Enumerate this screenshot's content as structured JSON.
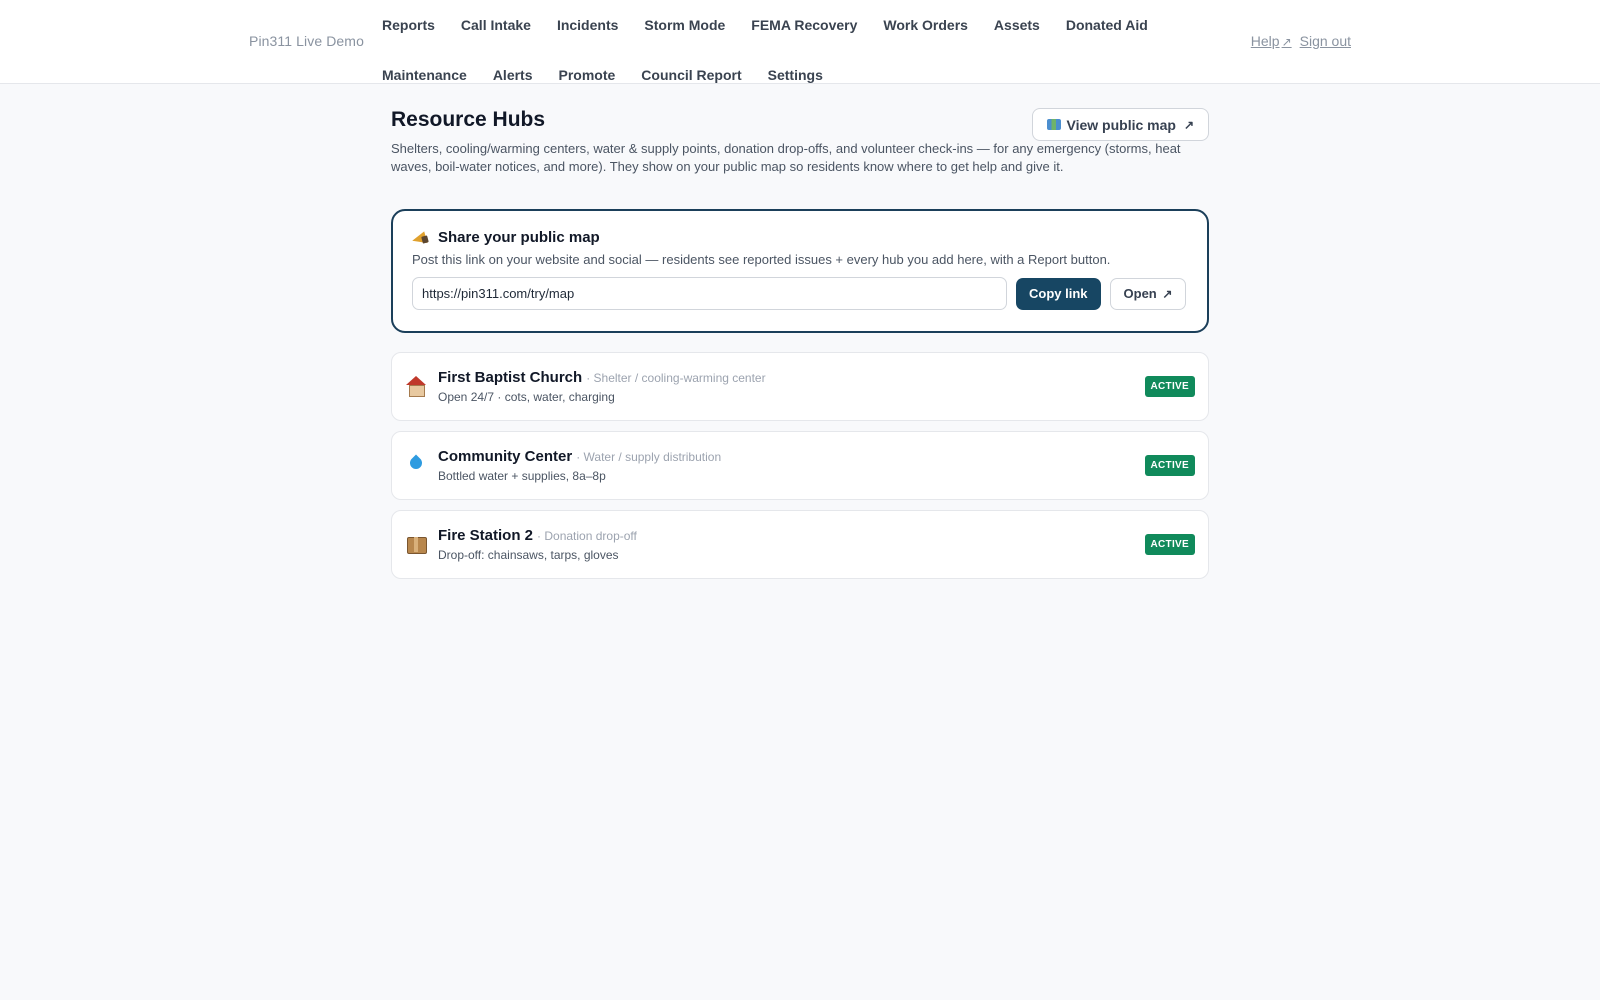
{
  "header": {
    "brand": "Pin311 Live Demo",
    "nav": [
      {
        "label": "Reports"
      },
      {
        "label": "Call Intake"
      },
      {
        "label": "Incidents"
      },
      {
        "label": "Storm Mode"
      },
      {
        "label": "FEMA Recovery"
      },
      {
        "label": "Work Orders"
      },
      {
        "label": "Assets"
      },
      {
        "label": "Donated Aid"
      },
      {
        "label": "Maintenance"
      },
      {
        "label": "Alerts"
      },
      {
        "label": "Promote"
      },
      {
        "label": "Council Report"
      },
      {
        "label": "Settings"
      }
    ],
    "help_label": "Help",
    "signout_label": "Sign out",
    "ext_glyph": "↗"
  },
  "page": {
    "title": "Resource Hubs",
    "description": "Shelters, cooling/warming centers, water & supply points, donation drop-offs, and volunteer check-ins — for any emergency (storms, heat waves, boil-water notices, and more). They show on your public map so residents know where to get help and give it.",
    "view_map_label": "View public map",
    "view_map_icon": "map-icon"
  },
  "share": {
    "icon": "megaphone-icon",
    "title": "Share your public map",
    "description": "Post this link on your website and social — residents see reported issues + every hub you add here, with a Report button.",
    "url_value": "https://pin311.com/try/map",
    "copy_label": "Copy link",
    "open_label": "Open"
  },
  "hubs": [
    {
      "icon": "house-icon",
      "name": "First Baptist Church",
      "type": "· Shelter / cooling-warming center",
      "details": "Open 24/7 · cots, water, charging",
      "status": "ACTIVE"
    },
    {
      "icon": "water-drop-icon",
      "name": "Community Center",
      "type": "· Water / supply distribution",
      "details": "Bottled water + supplies, 8a–8p",
      "status": "ACTIVE"
    },
    {
      "icon": "package-icon",
      "name": "Fire Station 2",
      "type": "· Donation drop-off",
      "details": "Drop-off: chainsaws, tarps, gloves",
      "status": "ACTIVE"
    }
  ],
  "colors": {
    "primary": "#174663",
    "share_border": "#1b3f5a",
    "active_badge": "#108a5b",
    "background": "#f8f9fb"
  }
}
